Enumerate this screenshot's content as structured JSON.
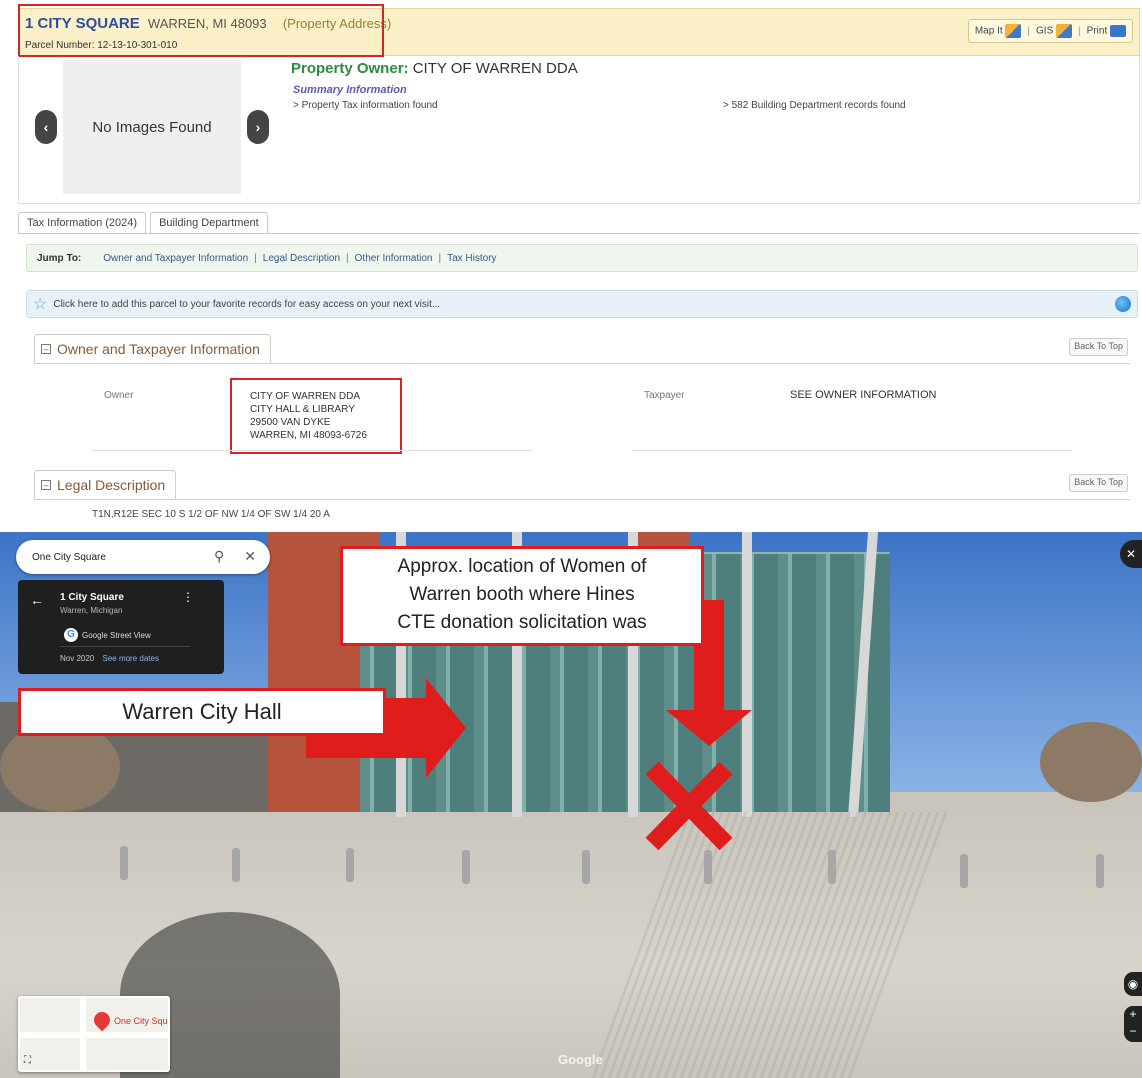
{
  "header": {
    "street": "1 CITY SQUARE",
    "city": "WARREN, MI 48093",
    "tag": "(Property Address)",
    "parcel": "Parcel Number: 12-13-10-301-010",
    "tools": {
      "map": "Map It",
      "gis": "GIS",
      "print": "Print"
    }
  },
  "photo": {
    "empty_text": "No Images Found"
  },
  "owner": {
    "label": "Property Owner:",
    "name": "CITY OF WARREN DDA"
  },
  "summary": {
    "title": "Summary Information",
    "item1": "> Property Tax information found",
    "item2": "> 582 Building Department records found"
  },
  "tabs": [
    "Tax Information (2024)",
    "Building Department"
  ],
  "jump": {
    "label": "Jump To:",
    "links": [
      "Owner and Taxpayer Information",
      "Legal Description",
      "Other Information",
      "Tax History"
    ],
    "sep": "|"
  },
  "favorites": {
    "text": "Click here to add this parcel to your favorite records for easy access on your next visit..."
  },
  "section_owner": {
    "title": "Owner and Taxpayer Information",
    "back": "Back To Top",
    "owner_label": "Owner",
    "owner_lines": [
      "CITY OF WARREN DDA",
      "CITY HALL & LIBRARY",
      "29500 VAN DYKE",
      "WARREN, MI 48093-6726"
    ],
    "taxpayer_label": "Taxpayer",
    "taxpayer_value": "SEE OWNER INFORMATION"
  },
  "section_legal": {
    "title": "Legal Description",
    "back": "Back To Top",
    "text": "T1N,R12E SEC 10 S 1/2 OF NW 1/4 OF SW 1/4 20 A"
  },
  "streetview": {
    "search_value": "One City Square",
    "card_title": "1 City Square",
    "card_sub": "Warren, Michigan",
    "card_source": "Google Street View",
    "card_date": "Nov 2020",
    "card_more": "See more dates",
    "callout_lines": [
      "Approx. location of Women of",
      "Warren booth where Hines",
      "CTE donation solicitation was"
    ],
    "cityhall_label": "Warren City Hall",
    "minimap_label": "One City Squ",
    "logo": "Google",
    "marker_color": "#e01d1d"
  }
}
